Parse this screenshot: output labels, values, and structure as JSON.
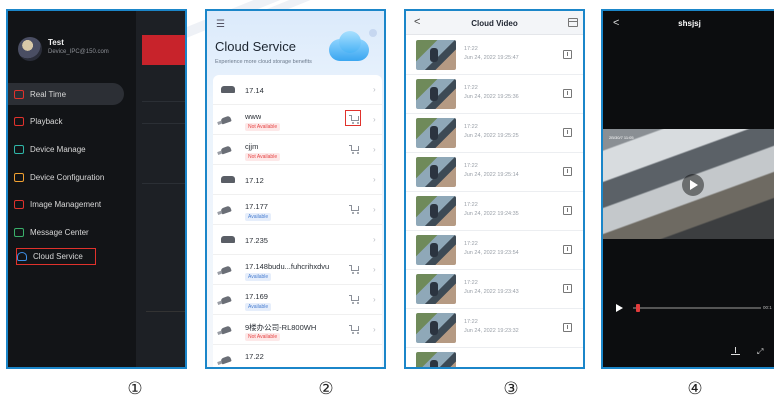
{
  "panel1": {
    "user_name": "Test",
    "user_email": "Device_IPC@150.com",
    "menu": [
      {
        "label": "Real Time"
      },
      {
        "label": "Playback"
      },
      {
        "label": "Device Manage"
      },
      {
        "label": "Device Configuration"
      },
      {
        "label": "Image Management"
      },
      {
        "label": "Message Center"
      },
      {
        "label": "Cloud Service"
      }
    ],
    "caption": "①"
  },
  "panel2": {
    "menu_glyph": "☰",
    "title": "Cloud Service",
    "subtitle": "Experience more cloud storage benefits",
    "devices": [
      {
        "name": "17.14",
        "status": ""
      },
      {
        "name": "www",
        "status": "Not Available"
      },
      {
        "name": "cjjm",
        "status": "Not Available"
      },
      {
        "name": "17.12",
        "status": ""
      },
      {
        "name": "17.177",
        "status": "Available"
      },
      {
        "name": "17.235",
        "status": ""
      },
      {
        "name": "17.148budu...fuhcrihxdvu",
        "status": "Available"
      },
      {
        "name": "17.169",
        "status": "Available"
      },
      {
        "name": "9楼办公司-RL800WH",
        "status": "Not Available"
      },
      {
        "name": "17.22",
        "status": ""
      }
    ],
    "caption": "②"
  },
  "panel3": {
    "title": "Cloud Video",
    "back_glyph": "<",
    "videos": [
      {
        "time": "17:22",
        "date": "Jun 24, 2022 19:25:47"
      },
      {
        "time": "17:22",
        "date": "Jun 24, 2022 19:25:36"
      },
      {
        "time": "17:22",
        "date": "Jun 24, 2022 19:25:25"
      },
      {
        "time": "17:22",
        "date": "Jun 24, 2022 19:25:14"
      },
      {
        "time": "17:22",
        "date": "Jun 24, 2022 19:24:35"
      },
      {
        "time": "17:22",
        "date": "Jun 24, 2022 19:23:54"
      },
      {
        "time": "17:22",
        "date": "Jun 24, 2022 19:23:43"
      },
      {
        "time": "17:22",
        "date": "Jun 24, 2022 19:23:32"
      }
    ],
    "caption": "③"
  },
  "panel4": {
    "title": "shsjsj",
    "back_glyph": "<",
    "osd": "2B/30/7 11:05",
    "end_time": "00:1",
    "fullscreen_glyph": "⤢",
    "caption": "④"
  },
  "colors": {
    "frame_border": "#1b86c9",
    "highlight_red": "#e0322c",
    "available_blue": "#4a7fd1",
    "not_available_red": "#e64545"
  }
}
